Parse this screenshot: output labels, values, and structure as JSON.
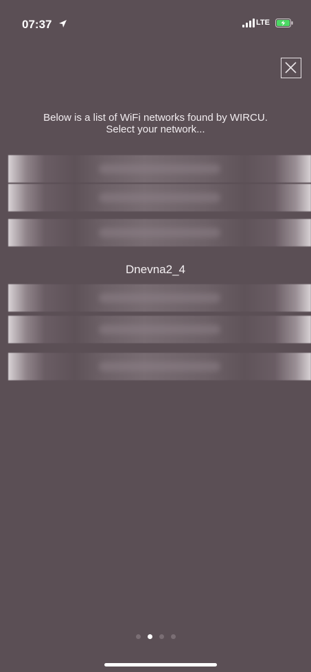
{
  "status_bar": {
    "time": "07:37",
    "network": "LTE"
  },
  "intro": {
    "line1": "Below is a list of WiFi networks found by WIRCU.",
    "line2": "Select your network..."
  },
  "networks": {
    "visible_name": "Dnevna2_4",
    "obscured_count_above": 3,
    "obscured_count_below": 3
  },
  "pager": {
    "page_count": 4,
    "current_page": 2
  },
  "colors": {
    "background": "#5b4f55",
    "text": "#f2eef0",
    "active_dot": "#ffffff",
    "inactive_dot": "#7a6e74"
  }
}
